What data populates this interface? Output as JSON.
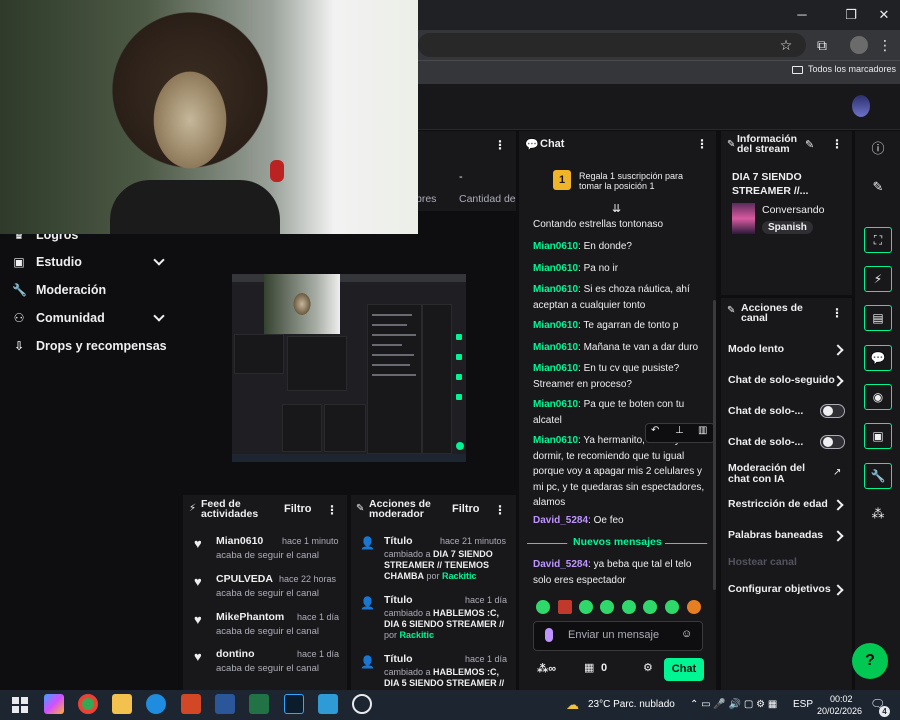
{
  "browser": {
    "bookmarks_all": "Todos los marcadores",
    "window_buttons": [
      "─",
      "❐",
      "✕"
    ]
  },
  "nav": {
    "items": [
      {
        "label": "Logros",
        "icon": "trophy-icon"
      },
      {
        "label": "Estudio",
        "icon": "studio-icon",
        "expandable": true
      },
      {
        "label": "Moderación",
        "icon": "wrench-icon"
      },
      {
        "label": "Comunidad",
        "icon": "community-icon",
        "expandable": true
      },
      {
        "label": "Drops y recompensas",
        "icon": "drops-icon"
      }
    ]
  },
  "hidden_panel": {
    "fragment_1": "-",
    "fragment_2": "pres",
    "fragment_3": "Cantidad de"
  },
  "chat": {
    "title": "Chat",
    "promo": "Regala 1 suscripción para tomar la posición 1",
    "promo_rank": "1",
    "partial_message": "Contando estrellas tontonaso",
    "messages": [
      {
        "user": "Mian0610",
        "text": ": En donde?",
        "color": "green"
      },
      {
        "user": "Mian0610",
        "text": ": Pa no ir",
        "color": "green"
      },
      {
        "user": "Mian0610",
        "text": ": Si es choza náutica, ahí aceptan a cualquier tonto",
        "color": "green"
      },
      {
        "user": "Mian0610",
        "text": ": Te agarran de tonto p",
        "color": "green"
      },
      {
        "user": "Mian0610",
        "text": ": Mañana te van a dar duro",
        "color": "green"
      },
      {
        "user": "Mian0610",
        "text": ": En tu cv que pusiste? Streamer en proceso?",
        "color": "green"
      },
      {
        "user": "Mian0610",
        "text": ": Pa que te boten con tu alcatel",
        "color": "green"
      },
      {
        "user": "Mian0610",
        "text": ": Ya hermanito, me voy a dormir, te recomiendo que tu igual porque voy a apagar mis 2 celulares y mi pc, y te quedaras sin espectadores, alamos",
        "color": "green"
      },
      {
        "user": "David_5284",
        "text": ": Oe feo",
        "color": "purple"
      }
    ],
    "new_messages_label": "Nuevos mensajes",
    "after_new": [
      {
        "user": "David_5284",
        "text": ": ya beba que tal el telo solo eres espectador",
        "color": "purple"
      }
    ],
    "input_placeholder": "Enviar un mensaje",
    "points_value": "0",
    "send_label": "Chat"
  },
  "stream_info": {
    "title": "Información del stream",
    "stream_title": "DIA 7 SIENDO STREAMER //...",
    "category": "Conversando",
    "language": "Spanish"
  },
  "channel_actions": {
    "title": "Acciones de canal",
    "items": [
      {
        "label": "Modo lento",
        "control": "arrow"
      },
      {
        "label": "Chat de solo-seguido",
        "control": "arrow"
      },
      {
        "label": "Chat de solo-...",
        "control": "toggle"
      },
      {
        "label": "Chat de solo-...",
        "control": "toggle"
      },
      {
        "label": "Moderación del chat con IA",
        "control": "external"
      },
      {
        "label": "Restricción de edad",
        "control": "arrow"
      },
      {
        "label": "Palabras baneadas",
        "control": "arrow"
      },
      {
        "label": "Hostear canal",
        "control": "disabled"
      },
      {
        "label": "Configurar objetivos",
        "control": "arrow"
      }
    ]
  },
  "activity_feed": {
    "title": "Feed de actividades",
    "filter_label": "Filtro",
    "items": [
      {
        "name": "Mian0610",
        "time": "hace 1 minuto",
        "action": "acaba de seguir el canal"
      },
      {
        "name": "CPULVEDA",
        "time": "hace 22 horas",
        "action": "acaba de seguir el canal"
      },
      {
        "name": "MikePhantom",
        "time": "hace 1 día",
        "action": "acaba de seguir el canal"
      },
      {
        "name": "dontino",
        "time": "hace 1 día",
        "action": "acaba de seguir el canal"
      }
    ]
  },
  "mod_actions": {
    "title": "Acciones de moderador",
    "filter_label": "Filtro",
    "items": [
      {
        "name": "Título",
        "time": "hace 21 minutos",
        "prefix": "cambiado a ",
        "value": "DIA 7 SIENDO STREAMER // TENEMOS CHAMBA",
        "by": " por ",
        "mod": "Rackitic"
      },
      {
        "name": "Título",
        "time": "hace 1 día",
        "prefix": "cambiado a ",
        "value": "HABLEMOS :C, DIA 6 SIENDO STREAMER //",
        "by": " por ",
        "mod": "Rackitic"
      },
      {
        "name": "Título",
        "time": "hace 1 día",
        "prefix": "cambiado a ",
        "value": "HABLEMOS :C, DIA 5 SIENDO STREAMER //",
        "by": "",
        "mod": ""
      }
    ]
  },
  "taskbar": {
    "weather": "23°C  Parc. nublado",
    "lang": "ESP",
    "time": "00:02",
    "date": "20/02/2026",
    "notifications": "4"
  }
}
